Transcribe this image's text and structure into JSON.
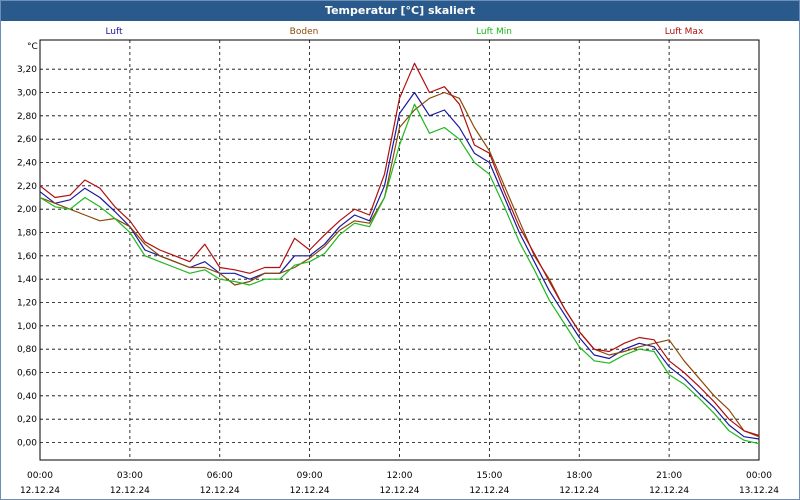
{
  "chart_data": {
    "type": "line",
    "title": "Temperatur [°C] skaliert",
    "ylabel": "°C",
    "ylim": [
      -0.15,
      3.45
    ],
    "yticks": [
      "0,00",
      "0,20",
      "0,40",
      "0,60",
      "0,80",
      "1,00",
      "1,20",
      "1,40",
      "1,60",
      "1,80",
      "2,00",
      "2,20",
      "2,40",
      "2,60",
      "2,80",
      "3,00",
      "3,20"
    ],
    "xticks": [
      {
        "time": "00:00",
        "date": "12.12.24"
      },
      {
        "time": "03:00",
        "date": "12.12.24"
      },
      {
        "time": "06:00",
        "date": "12.12.24"
      },
      {
        "time": "09:00",
        "date": "12.12.24"
      },
      {
        "time": "12:00",
        "date": "12.12.24"
      },
      {
        "time": "15:00",
        "date": "12.12.24"
      },
      {
        "time": "18:00",
        "date": "12.12.24"
      },
      {
        "time": "21:00",
        "date": "12.12.24"
      },
      {
        "time": "00:00",
        "date": "13.12.24"
      }
    ],
    "grid": true,
    "legend_position": "top",
    "series": [
      {
        "name": "Luft",
        "color": "#1a1aa0",
        "x": [
          0,
          0.5,
          1,
          1.5,
          2,
          2.5,
          3,
          3.5,
          4,
          4.5,
          5,
          5.5,
          6,
          6.5,
          7,
          7.5,
          8,
          8.5,
          9,
          9.5,
          10,
          10.5,
          11,
          11.5,
          12,
          12.5,
          13,
          13.5,
          14,
          14.5,
          15,
          15.5,
          16,
          16.5,
          17,
          17.5,
          18,
          18.5,
          19,
          19.5,
          20,
          20.5,
          21,
          21.5,
          22,
          22.5,
          23,
          23.5,
          24
        ],
        "y": [
          2.15,
          2.05,
          2.08,
          2.18,
          2.1,
          1.98,
          1.85,
          1.65,
          1.6,
          1.55,
          1.5,
          1.55,
          1.45,
          1.45,
          1.4,
          1.45,
          1.45,
          1.6,
          1.6,
          1.7,
          1.85,
          1.95,
          1.9,
          2.2,
          2.82,
          3.0,
          2.8,
          2.85,
          2.7,
          2.48,
          2.4,
          2.1,
          1.8,
          1.55,
          1.3,
          1.1,
          0.9,
          0.75,
          0.72,
          0.8,
          0.85,
          0.82,
          0.65,
          0.55,
          0.42,
          0.3,
          0.15,
          0.05,
          0.03
        ]
      },
      {
        "name": "Boden",
        "color": "#8a4a0a",
        "x": [
          0,
          0.5,
          1,
          1.5,
          2,
          2.5,
          3,
          3.5,
          4,
          4.5,
          5,
          5.5,
          6,
          6.5,
          7,
          7.5,
          8,
          8.5,
          9,
          9.5,
          10,
          10.5,
          11,
          11.5,
          12,
          12.5,
          13,
          13.5,
          14,
          14.5,
          15,
          15.5,
          16,
          16.5,
          17,
          17.5,
          18,
          18.5,
          19,
          19.5,
          20,
          20.5,
          21,
          21.5,
          22,
          22.5,
          23,
          23.5,
          24
        ],
        "y": [
          2.1,
          2.05,
          2.0,
          1.95,
          1.9,
          1.92,
          1.85,
          1.7,
          1.6,
          1.55,
          1.5,
          1.5,
          1.45,
          1.35,
          1.38,
          1.45,
          1.45,
          1.5,
          1.58,
          1.68,
          1.82,
          1.9,
          1.88,
          2.1,
          2.7,
          2.85,
          2.95,
          3.0,
          2.95,
          2.7,
          2.5,
          2.2,
          1.9,
          1.6,
          1.4,
          1.15,
          0.95,
          0.8,
          0.75,
          0.78,
          0.82,
          0.85,
          0.88,
          0.7,
          0.55,
          0.4,
          0.28,
          0.1,
          0.05
        ]
      },
      {
        "name": "Luft Min",
        "color": "#1fb81f",
        "x": [
          0,
          0.5,
          1,
          1.5,
          2,
          2.5,
          3,
          3.5,
          4,
          4.5,
          5,
          5.5,
          6,
          6.5,
          7,
          7.5,
          8,
          8.5,
          9,
          9.5,
          10,
          10.5,
          11,
          11.5,
          12,
          12.5,
          13,
          13.5,
          14,
          14.5,
          15,
          15.5,
          16,
          16.5,
          17,
          17.5,
          18,
          18.5,
          19,
          19.5,
          20,
          20.5,
          21,
          21.5,
          22,
          22.5,
          23,
          23.5,
          24
        ],
        "y": [
          2.1,
          2.02,
          2.0,
          2.1,
          2.02,
          1.92,
          1.8,
          1.6,
          1.55,
          1.5,
          1.45,
          1.48,
          1.4,
          1.38,
          1.35,
          1.4,
          1.4,
          1.52,
          1.55,
          1.62,
          1.78,
          1.88,
          1.85,
          2.1,
          2.55,
          2.9,
          2.65,
          2.7,
          2.6,
          2.4,
          2.3,
          2.02,
          1.72,
          1.48,
          1.22,
          1.02,
          0.82,
          0.7,
          0.68,
          0.75,
          0.8,
          0.78,
          0.58,
          0.5,
          0.38,
          0.25,
          0.1,
          0.02,
          -0.01
        ]
      },
      {
        "name": "Luft Max",
        "color": "#b01010",
        "x": [
          0,
          0.5,
          1,
          1.5,
          2,
          2.5,
          3,
          3.5,
          4,
          4.5,
          5,
          5.5,
          6,
          6.5,
          7,
          7.5,
          8,
          8.5,
          9,
          9.5,
          10,
          10.5,
          11,
          11.5,
          12,
          12.5,
          13,
          13.5,
          14,
          14.5,
          15,
          15.5,
          16,
          16.5,
          17,
          17.5,
          18,
          18.5,
          19,
          19.5,
          20,
          20.5,
          21,
          21.5,
          22,
          22.5,
          23,
          23.5,
          24
        ],
        "y": [
          2.2,
          2.1,
          2.12,
          2.25,
          2.18,
          2.02,
          1.9,
          1.72,
          1.65,
          1.6,
          1.55,
          1.7,
          1.5,
          1.48,
          1.45,
          1.5,
          1.5,
          1.75,
          1.65,
          1.78,
          1.9,
          2.0,
          1.95,
          2.3,
          2.95,
          3.25,
          3.0,
          3.05,
          2.9,
          2.55,
          2.48,
          2.15,
          1.85,
          1.62,
          1.38,
          1.15,
          0.95,
          0.8,
          0.78,
          0.85,
          0.9,
          0.88,
          0.7,
          0.6,
          0.48,
          0.35,
          0.2,
          0.1,
          0.06
        ]
      }
    ]
  }
}
